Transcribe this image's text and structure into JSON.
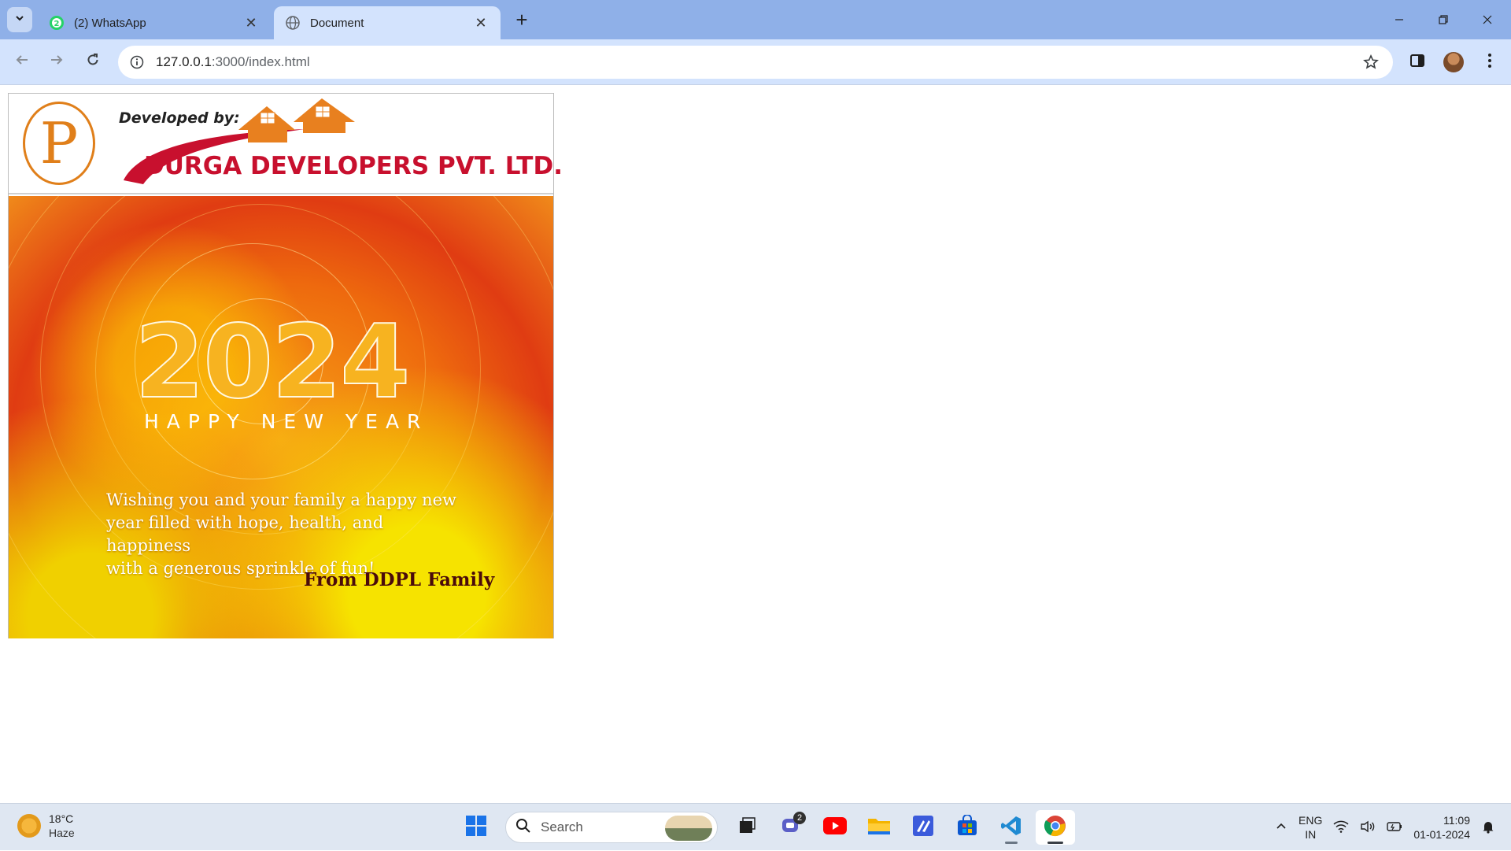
{
  "browser": {
    "tabs": [
      {
        "title": "(2) WhatsApp",
        "badge": "2",
        "active": false
      },
      {
        "title": "Document",
        "active": true
      }
    ],
    "url_host": "127.0.0.1",
    "url_path": ":3000/index.html"
  },
  "page": {
    "header": {
      "developed_by": "Developed by:",
      "company": "DURGA DEVELOPERS PVT. LTD."
    },
    "card": {
      "year": "2024",
      "subtitle": "HAPPY NEW YEAR",
      "wish_lines": [
        "Wishing you and your family a happy new",
        "year filled with hope, health, and happiness",
        "with a generous sprinkle of fun!"
      ],
      "from": "From DDPL Family"
    }
  },
  "taskbar": {
    "weather_temp": "18°C",
    "weather_condition": "Haze",
    "search_placeholder": "Search",
    "teams_badge": "2",
    "lang_top": "ENG",
    "lang_bottom": "IN",
    "time": "11:09",
    "date": "01-01-2024"
  },
  "colors": {
    "tabstrip": "#8fb0e8",
    "toolbar": "#d3e3fd",
    "company_red": "#c8102e",
    "logo_orange": "#e07f1a",
    "from_text": "#4a0b0b"
  }
}
